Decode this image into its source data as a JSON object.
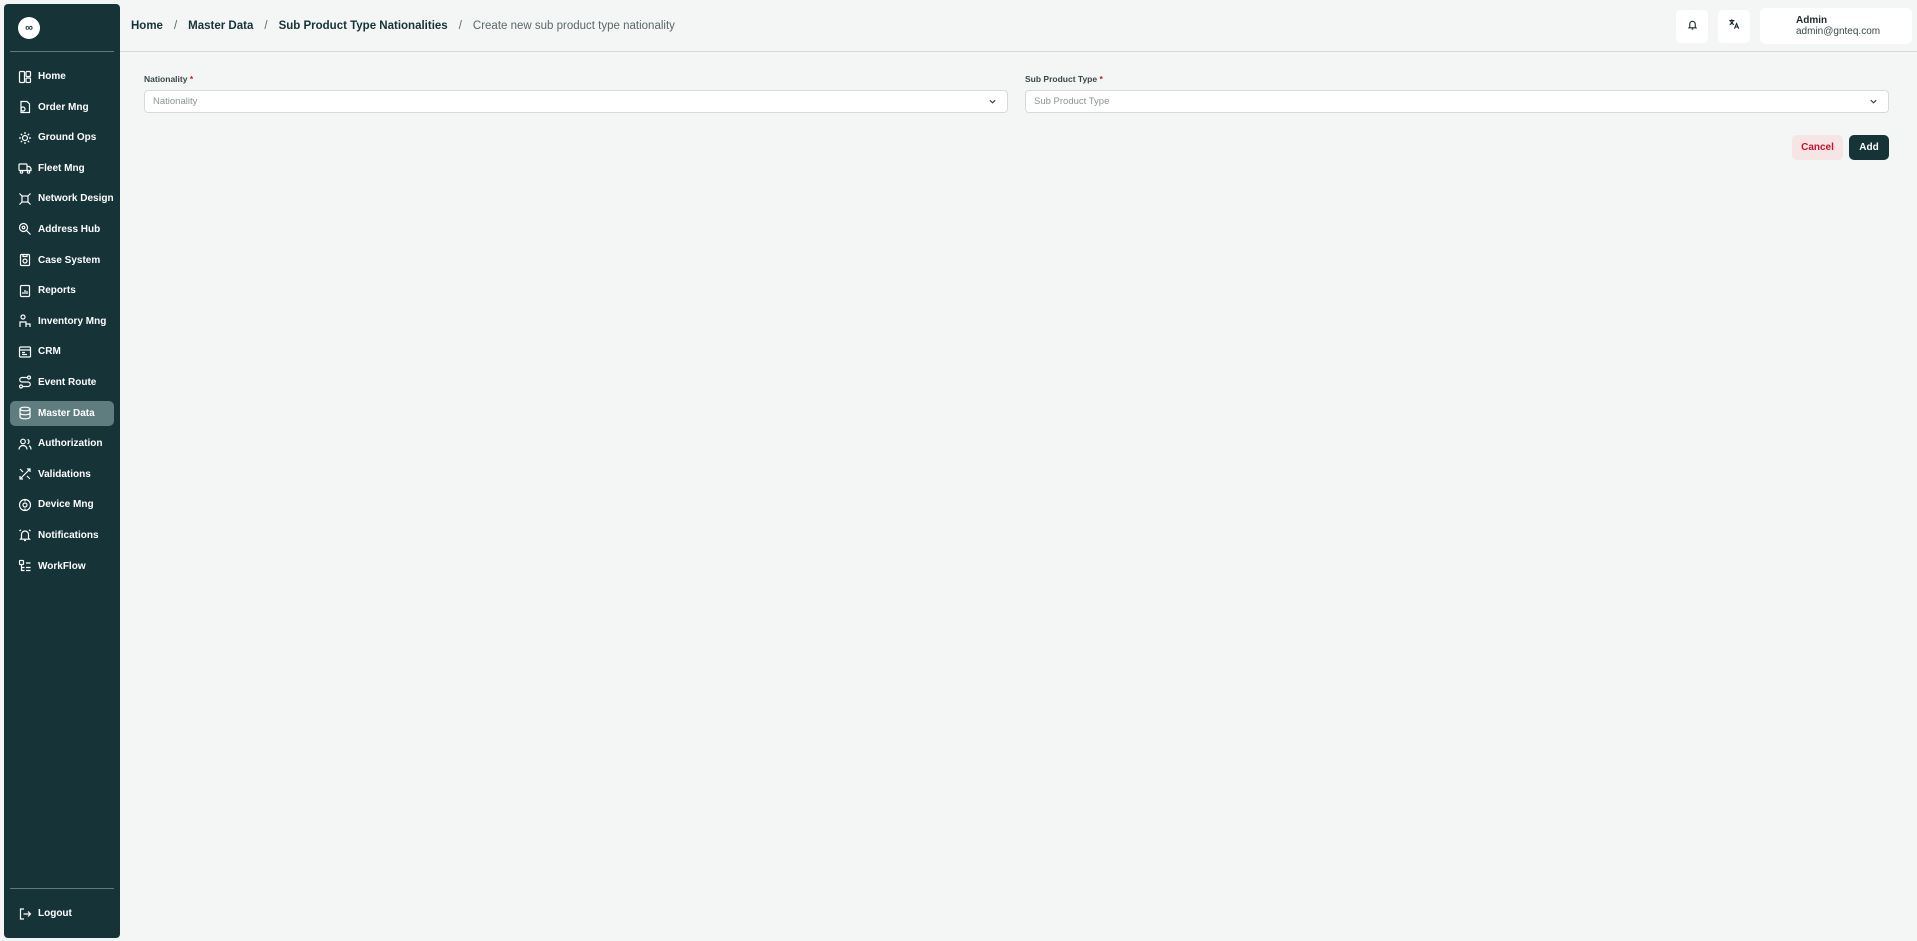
{
  "app": {
    "logo_text": "∞"
  },
  "sidebar": {
    "items": [
      {
        "label": "Home",
        "icon": "home-icon"
      },
      {
        "label": "Order Mng",
        "icon": "order-icon"
      },
      {
        "label": "Ground Ops",
        "icon": "ground-ops-icon"
      },
      {
        "label": "Fleet Mng",
        "icon": "truck-icon"
      },
      {
        "label": "Network Design",
        "icon": "network-icon"
      },
      {
        "label": "Address Hub",
        "icon": "address-icon"
      },
      {
        "label": "Case System",
        "icon": "case-icon"
      },
      {
        "label": "Reports",
        "icon": "report-icon"
      },
      {
        "label": "Inventory Mng",
        "icon": "inventory-icon"
      },
      {
        "label": "CRM",
        "icon": "crm-icon"
      },
      {
        "label": "Event Route",
        "icon": "route-icon"
      },
      {
        "label": "Master Data",
        "icon": "database-icon",
        "active": true
      },
      {
        "label": "Authorization",
        "icon": "users-icon"
      },
      {
        "label": "Validations",
        "icon": "validation-icon"
      },
      {
        "label": "Device Mng",
        "icon": "device-icon"
      },
      {
        "label": "Notifications",
        "icon": "bell-icon"
      },
      {
        "label": "WorkFlow",
        "icon": "workflow-icon"
      }
    ],
    "logout_label": "Logout"
  },
  "header": {
    "breadcrumb": [
      {
        "label": "Home"
      },
      {
        "label": "Master Data"
      },
      {
        "label": "Sub Product Type Nationalities"
      },
      {
        "label": "Create new sub product type nationality"
      }
    ],
    "separator": "/",
    "user": {
      "name": "Admin",
      "email": "admin@gnteq.com"
    }
  },
  "form": {
    "nationality": {
      "label": "Nationality",
      "required_mark": "*",
      "placeholder": "Nationality"
    },
    "sub_product_type": {
      "label": "Sub Product Type",
      "required_mark": "*",
      "placeholder": "Sub Product Type"
    },
    "cancel_label": "Cancel",
    "add_label": "Add"
  },
  "colors": {
    "sidebar_bg": "#163338",
    "active_item_bg": "#5f7c7f",
    "page_bg": "#f4f6f5",
    "required": "#c8102e",
    "primary": "#163338"
  }
}
